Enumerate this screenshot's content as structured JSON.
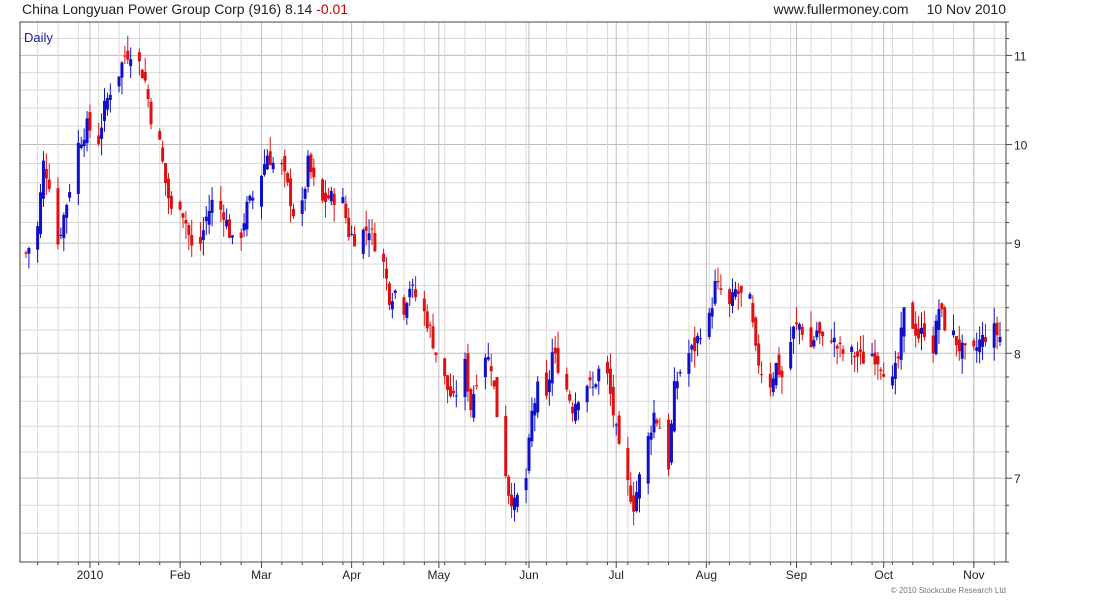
{
  "header": {
    "company": "China Longyuan Power Group Corp (916)",
    "last_price": "8.14",
    "change": "-0.01",
    "website": "www.fullermoney.com",
    "date": "10 Nov 2010"
  },
  "footer": {
    "copyright": "© 2010 Stockcube Research Ltd"
  },
  "colors": {
    "up": "#1010c8",
    "down": "#dd1111",
    "grid": "#d9d9d9",
    "grid_major": "#bdbdbd",
    "axis": "#444444"
  },
  "chart_data": {
    "type": "candlestick",
    "title": "China Longyuan Power Group Corp (916)",
    "period_label": "Daily",
    "x_range": [
      "2009-12-10",
      "2010-11-10"
    ],
    "ylim": [
      6.4,
      11.4
    ],
    "y_scale": "log",
    "y_ticks": [
      7,
      8,
      9,
      10,
      11
    ],
    "x_ticks": [
      {
        "label": "2010",
        "date": "2010-01-01"
      },
      {
        "label": "Feb",
        "date": "2010-02-01"
      },
      {
        "label": "Mar",
        "date": "2010-03-01"
      },
      {
        "label": "Apr",
        "date": "2010-04-01"
      },
      {
        "label": "May",
        "date": "2010-05-01"
      },
      {
        "label": "Jun",
        "date": "2010-06-01"
      },
      {
        "label": "Jul",
        "date": "2010-07-01"
      },
      {
        "label": "Aug",
        "date": "2010-08-01"
      },
      {
        "label": "Sep",
        "date": "2010-09-01"
      },
      {
        "label": "Oct",
        "date": "2010-10-01"
      },
      {
        "label": "Nov",
        "date": "2010-11-01"
      }
    ],
    "grid": true,
    "close_anchors": [
      [
        "2009-12-10",
        8.9
      ],
      [
        "2009-12-14",
        9.15
      ],
      [
        "2009-12-16",
        9.8
      ],
      [
        "2009-12-18",
        9.6
      ],
      [
        "2009-12-21",
        9.0
      ],
      [
        "2009-12-24",
        9.4
      ],
      [
        "2009-12-28",
        10.0
      ],
      [
        "2009-12-31",
        10.2
      ],
      [
        "2010-01-04",
        10.05
      ],
      [
        "2010-01-06",
        10.4
      ],
      [
        "2010-01-08",
        10.6
      ],
      [
        "2010-01-11",
        10.8
      ],
      [
        "2010-01-13",
        11.0
      ],
      [
        "2010-01-15",
        11.05
      ],
      [
        "2010-01-18",
        10.9
      ],
      [
        "2010-01-20",
        10.7
      ],
      [
        "2010-01-22",
        10.3
      ],
      [
        "2010-01-25",
        10.0
      ],
      [
        "2010-01-27",
        9.6
      ],
      [
        "2010-01-29",
        9.3
      ],
      [
        "2010-02-01",
        9.4
      ],
      [
        "2010-02-03",
        9.2
      ],
      [
        "2010-02-05",
        8.95
      ],
      [
        "2010-02-08",
        9.0
      ],
      [
        "2010-02-10",
        9.25
      ],
      [
        "2010-02-12",
        9.4
      ],
      [
        "2010-02-16",
        9.3
      ],
      [
        "2010-02-19",
        9.0
      ],
      [
        "2010-02-22",
        9.1
      ],
      [
        "2010-02-24",
        9.35
      ],
      [
        "2010-02-26",
        9.45
      ],
      [
        "2010-03-01",
        9.7
      ],
      [
        "2010-03-03",
        9.9
      ],
      [
        "2010-03-05",
        9.8
      ],
      [
        "2010-03-08",
        9.75
      ],
      [
        "2010-03-10",
        9.55
      ],
      [
        "2010-03-12",
        9.3
      ],
      [
        "2010-03-15",
        9.35
      ],
      [
        "2010-03-17",
        9.8
      ],
      [
        "2010-03-19",
        9.6
      ],
      [
        "2010-03-22",
        9.4
      ],
      [
        "2010-03-24",
        9.45
      ],
      [
        "2010-03-26",
        9.45
      ],
      [
        "2010-03-29",
        9.4
      ],
      [
        "2010-03-31",
        9.1
      ],
      [
        "2010-04-02",
        9.05
      ],
      [
        "2010-04-07",
        9.15
      ],
      [
        "2010-04-09",
        9.0
      ],
      [
        "2010-04-12",
        8.8
      ],
      [
        "2010-04-14",
        8.5
      ],
      [
        "2010-04-16",
        8.55
      ],
      [
        "2010-04-19",
        8.4
      ],
      [
        "2010-04-21",
        8.6
      ],
      [
        "2010-04-23",
        8.5
      ],
      [
        "2010-04-26",
        8.35
      ],
      [
        "2010-04-28",
        8.2
      ],
      [
        "2010-04-30",
        8.0
      ],
      [
        "2010-05-04",
        7.7
      ],
      [
        "2010-05-06",
        7.6
      ],
      [
        "2010-05-10",
        7.9
      ],
      [
        "2010-05-12",
        7.55
      ],
      [
        "2010-05-14",
        7.8
      ],
      [
        "2010-05-17",
        8.0
      ],
      [
        "2010-05-19",
        7.9
      ],
      [
        "2010-05-21",
        7.5
      ],
      [
        "2010-05-25",
        6.9
      ],
      [
        "2010-05-27",
        6.8
      ],
      [
        "2010-05-31",
        7.0
      ],
      [
        "2010-06-02",
        7.5
      ],
      [
        "2010-06-04",
        7.7
      ],
      [
        "2010-06-07",
        7.6
      ],
      [
        "2010-06-09",
        8.0
      ],
      [
        "2010-06-11",
        7.9
      ],
      [
        "2010-06-14",
        7.7
      ],
      [
        "2010-06-16",
        7.55
      ],
      [
        "2010-06-18",
        7.65
      ],
      [
        "2010-06-21",
        7.75
      ],
      [
        "2010-06-23",
        7.7
      ],
      [
        "2010-06-25",
        7.85
      ],
      [
        "2010-06-28",
        7.8
      ],
      [
        "2010-06-30",
        7.5
      ],
      [
        "2010-07-02",
        7.2
      ],
      [
        "2010-07-05",
        6.95
      ],
      [
        "2010-07-07",
        6.8
      ],
      [
        "2010-07-09",
        7.0
      ],
      [
        "2010-07-12",
        7.3
      ],
      [
        "2010-07-14",
        7.5
      ],
      [
        "2010-07-16",
        7.4
      ],
      [
        "2010-07-19",
        7.1
      ],
      [
        "2010-07-21",
        7.7
      ],
      [
        "2010-07-23",
        7.85
      ],
      [
        "2010-07-26",
        8.0
      ],
      [
        "2010-07-28",
        8.05
      ],
      [
        "2010-07-30",
        8.2
      ],
      [
        "2010-08-02",
        8.3
      ],
      [
        "2010-08-04",
        8.6
      ],
      [
        "2010-08-06",
        8.55
      ],
      [
        "2010-08-09",
        8.4
      ],
      [
        "2010-08-11",
        8.55
      ],
      [
        "2010-08-13",
        8.5
      ],
      [
        "2010-08-16",
        8.45
      ],
      [
        "2010-08-18",
        8.0
      ],
      [
        "2010-08-20",
        7.85
      ],
      [
        "2010-08-23",
        7.75
      ],
      [
        "2010-08-25",
        7.9
      ],
      [
        "2010-08-27",
        7.8
      ],
      [
        "2010-08-31",
        8.2
      ],
      [
        "2010-09-02",
        8.25
      ],
      [
        "2010-09-06",
        8.05
      ],
      [
        "2010-09-08",
        8.2
      ],
      [
        "2010-09-10",
        8.1
      ],
      [
        "2010-09-13",
        8.15
      ],
      [
        "2010-09-15",
        8.05
      ],
      [
        "2010-09-17",
        8.0
      ],
      [
        "2010-09-20",
        8.0
      ],
      [
        "2010-09-24",
        7.95
      ],
      [
        "2010-09-27",
        8.0
      ],
      [
        "2010-09-29",
        7.95
      ],
      [
        "2010-10-04",
        7.75
      ],
      [
        "2010-10-06",
        7.95
      ],
      [
        "2010-10-08",
        8.35
      ],
      [
        "2010-10-11",
        8.25
      ],
      [
        "2010-10-13",
        8.15
      ],
      [
        "2010-10-15",
        8.2
      ],
      [
        "2010-10-18",
        8.05
      ],
      [
        "2010-10-20",
        8.4
      ],
      [
        "2010-10-22",
        8.25
      ],
      [
        "2010-10-25",
        8.15
      ],
      [
        "2010-10-27",
        8.05
      ],
      [
        "2010-10-29",
        8.0
      ],
      [
        "2010-11-01",
        8.0
      ],
      [
        "2010-11-03",
        8.1
      ],
      [
        "2010-11-05",
        8.15
      ],
      [
        "2010-11-08",
        8.2
      ],
      [
        "2010-11-10",
        8.14
      ]
    ]
  }
}
